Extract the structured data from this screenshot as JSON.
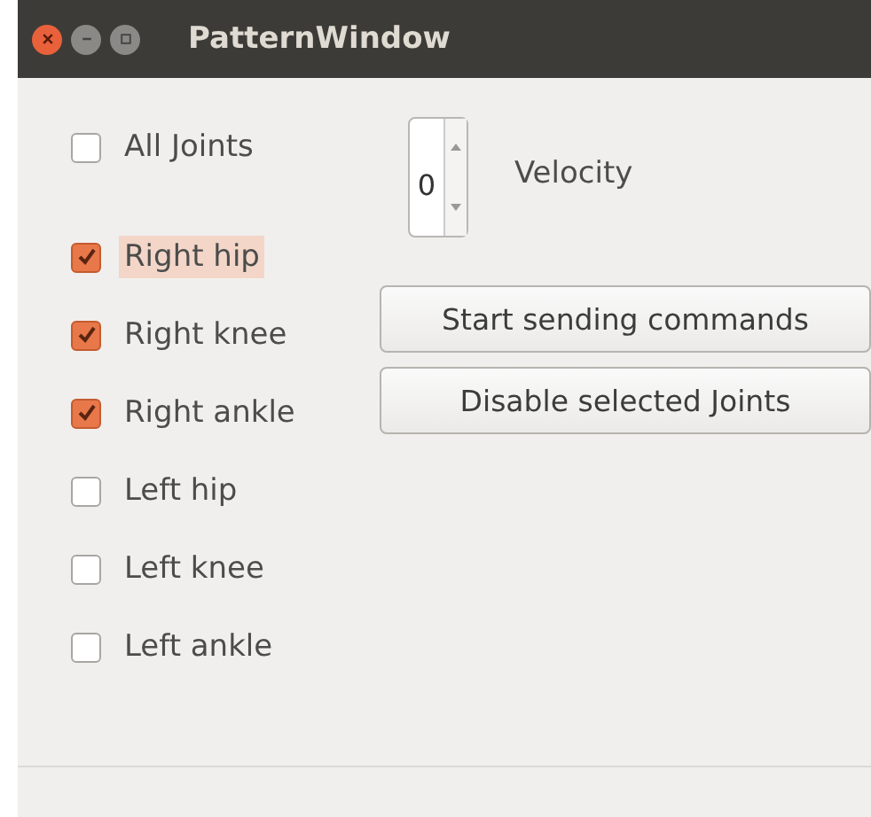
{
  "window": {
    "title": "PatternWindow"
  },
  "joints": [
    {
      "label": "All Joints",
      "checked": false,
      "focused": false
    },
    {
      "label": "Right hip",
      "checked": true,
      "focused": true
    },
    {
      "label": "Right knee",
      "checked": true,
      "focused": false
    },
    {
      "label": "Right ankle",
      "checked": true,
      "focused": false
    },
    {
      "label": "Left hip",
      "checked": false,
      "focused": false
    },
    {
      "label": "Left knee",
      "checked": false,
      "focused": false
    },
    {
      "label": "Left ankle",
      "checked": false,
      "focused": false
    }
  ],
  "velocity": {
    "value": "0",
    "label": "Velocity"
  },
  "buttons": [
    "Start sending commands",
    "Disable selected Joints"
  ]
}
